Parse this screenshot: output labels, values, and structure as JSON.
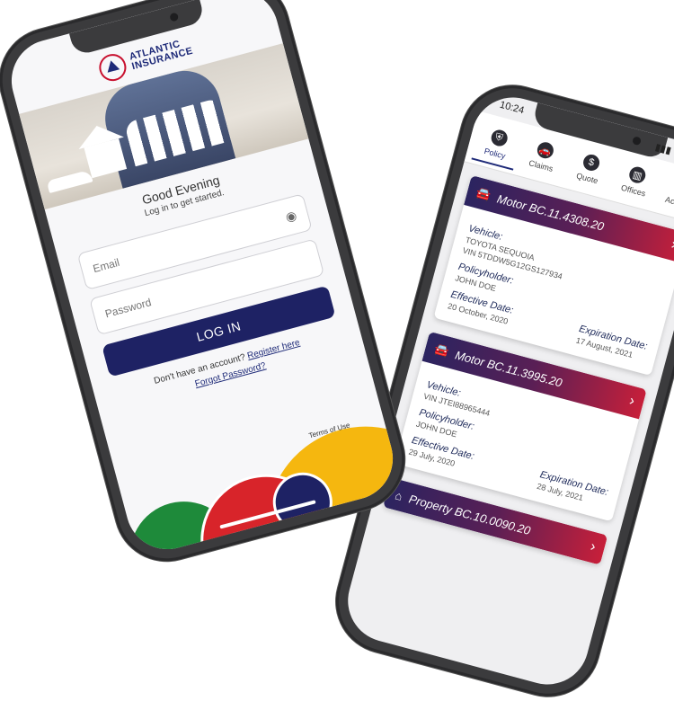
{
  "back_phone": {
    "status_time": "10:24",
    "nav": [
      {
        "label": "Policy",
        "icon": "shield-icon",
        "glyph": "⛨",
        "active": true
      },
      {
        "label": "Claims",
        "icon": "car-crash-icon",
        "glyph": "🚗"
      },
      {
        "label": "Quote",
        "icon": "dollar-icon",
        "glyph": "$"
      },
      {
        "label": "Offices",
        "icon": "building-icon",
        "glyph": "▥"
      },
      {
        "label": "Account",
        "icon": "user-icon",
        "glyph": "●"
      }
    ],
    "policies": [
      {
        "icon": "car-icon",
        "title": "Motor BC.11.4308.20",
        "vehicle_label": "Vehicle:",
        "vehicle": "TOYOTA SEQUOIA",
        "vin": "VIN 5TDDW5G12GS127934",
        "holder_label": "Policyholder:",
        "holder": "JOHN DOE",
        "eff_label": "Effective Date:",
        "eff": "20 October, 2020",
        "exp_label": "Expiration Date:",
        "exp": "17 August, 2021"
      },
      {
        "icon": "car-icon",
        "title": "Motor BC.11.3995.20",
        "vehicle_label": "Vehicle:",
        "vehicle": "",
        "vin": "VIN JTEI88965444",
        "holder_label": "Policyholder:",
        "holder": "JOHN DOE",
        "eff_label": "Effective Date:",
        "eff": "29 July, 2020",
        "exp_label": "Expiration Date:",
        "exp": "28 July, 2021"
      },
      {
        "icon": "house-icon",
        "title": "Property BC.10.0090.20",
        "vehicle_label": "",
        "vehicle": "",
        "vin": "",
        "holder_label": "",
        "holder": "",
        "eff_label": "",
        "eff": "",
        "exp_label": "",
        "exp": ""
      }
    ]
  },
  "front_phone": {
    "logo_line1": "ATLANTIC",
    "logo_line2": "INSURANCE",
    "greeting": "Good Evening",
    "subtitle": "Log in to get started.",
    "email_placeholder": "Email",
    "password_placeholder": "Password",
    "login_label": "LOG IN",
    "no_account": "Don't have an account?",
    "register_label": "Register here",
    "forgot_label": "Forgot Password?",
    "terms_label": "Terms of Use"
  },
  "colors": {
    "primary": "#1e2264",
    "accent_red": "#c71f3a",
    "yellow": "#f5b70f",
    "green": "#1e8a3a"
  }
}
